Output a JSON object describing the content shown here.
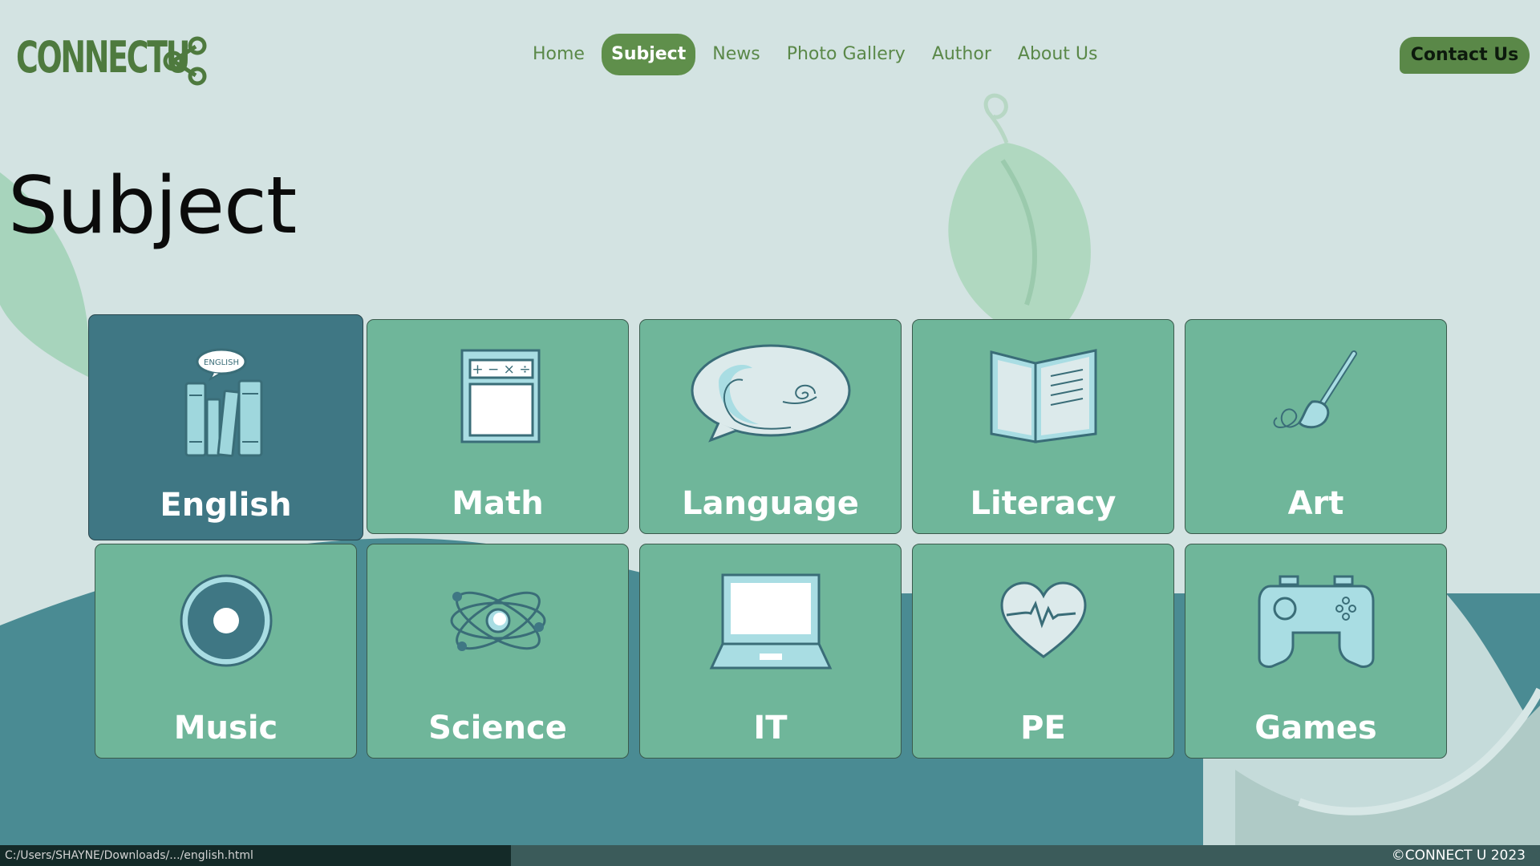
{
  "colors": {
    "accent": "#5f8f4b",
    "tile": "#6fb69a",
    "tile_active": "#3f7784",
    "background": "#d3e3e2",
    "wave": "#3f7784"
  },
  "logo": {
    "text": "CONNECTU",
    "icon": "share-icon"
  },
  "nav": {
    "items": [
      {
        "label": "Home"
      },
      {
        "label": "Subject",
        "active": true
      },
      {
        "label": "News"
      },
      {
        "label": "Photo Gallery"
      },
      {
        "label": "Author"
      },
      {
        "label": "About Us"
      }
    ],
    "contact_label": "Contact Us"
  },
  "page": {
    "title": "Subject"
  },
  "subjects": [
    {
      "label": "English",
      "icon": "books-icon",
      "active": true
    },
    {
      "label": "Math",
      "icon": "calculator-icon"
    },
    {
      "label": "Language",
      "icon": "speech-bubble-icon"
    },
    {
      "label": "Literacy",
      "icon": "open-book-icon"
    },
    {
      "label": "Art",
      "icon": "paintbrush-icon"
    },
    {
      "label": "Music",
      "icon": "disc-icon"
    },
    {
      "label": "Science",
      "icon": "atom-icon"
    },
    {
      "label": "IT",
      "icon": "laptop-icon"
    },
    {
      "label": "PE",
      "icon": "heartbeat-icon"
    },
    {
      "label": "Games",
      "icon": "gamepad-icon"
    }
  ],
  "statusbar": {
    "url": "C:/Users/SHAYNE/Downloads/.../english.html"
  },
  "footer": {
    "copyright": "©CONNECT U 2023"
  }
}
